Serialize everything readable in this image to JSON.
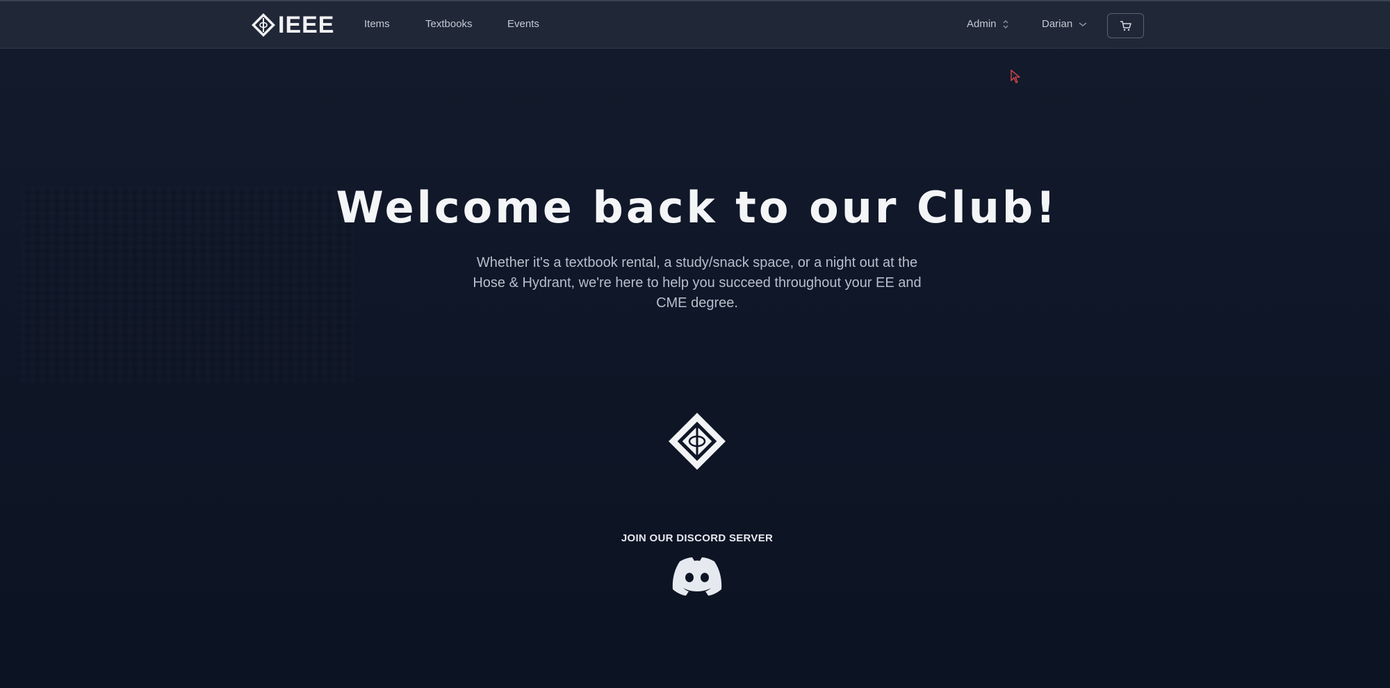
{
  "navbar": {
    "brand": "IEEE",
    "links": [
      "Items",
      "Textbooks",
      "Events"
    ],
    "admin_label": "Admin",
    "user_label": "Darian"
  },
  "hero": {
    "title": "Welcome back to our Club!",
    "subtitle": "Whether it's a textbook rental, a study/snack space, or a night out at the Hose & Hydrant, we're here to help you succeed throughout your EE and CME degree."
  },
  "discord": {
    "label": "JOIN OUR DISCORD SERVER"
  },
  "icons": {
    "brand_logo": "ieee-diamond-logo-icon",
    "admin_chevron": "chevron-updown-icon",
    "user_chevron": "chevron-down-icon",
    "cart": "shopping-cart-icon",
    "center_logo": "ieee-diamond-logo-icon",
    "discord": "discord-icon",
    "cursor": "mouse-cursor-icon"
  },
  "colors": {
    "background": "#0f1626",
    "navbar": "#202737",
    "text": "#e6e9ef",
    "cursor": "#e24b4b"
  }
}
